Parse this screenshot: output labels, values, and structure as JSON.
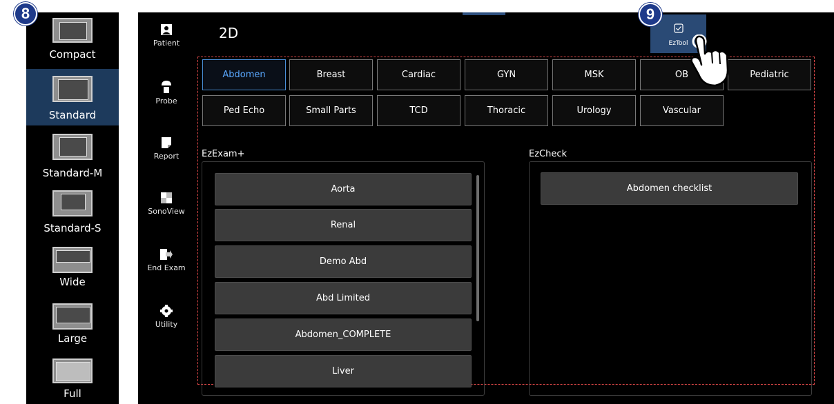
{
  "markers": {
    "left_panel": "8",
    "eztool": "9"
  },
  "layouts": [
    {
      "label": "Compact",
      "selected": false
    },
    {
      "label": "Standard",
      "selected": true
    },
    {
      "label": "Standard-M",
      "selected": false
    },
    {
      "label": "Standard-S",
      "selected": false
    },
    {
      "label": "Wide",
      "selected": false
    },
    {
      "label": "Large",
      "selected": false
    },
    {
      "label": "Full",
      "selected": false
    }
  ],
  "nav": [
    {
      "label": "Patient",
      "icon": "patient-icon"
    },
    {
      "label": "Probe",
      "icon": "probe-icon"
    },
    {
      "label": "Report",
      "icon": "report-icon"
    },
    {
      "label": "SonoView",
      "icon": "sonoview-icon"
    },
    {
      "label": "End Exam",
      "icon": "end-exam-icon"
    },
    {
      "label": "Utility",
      "icon": "utility-icon"
    }
  ],
  "screen_title": "2D",
  "eztool": {
    "label": "EzTool",
    "icon": "checkbox-icon"
  },
  "tabs_row1": [
    "Abdomen",
    "Breast",
    "Cardiac",
    "GYN",
    "MSK",
    "OB",
    "Pediatric"
  ],
  "tabs_row2": [
    "Ped Echo",
    "Small Parts",
    "TCD",
    "Thoracic",
    "Urology",
    "Vascular"
  ],
  "selected_tab": "Abdomen",
  "ezexam": {
    "title": "EzExam+",
    "items": [
      "Aorta",
      "Renal",
      "Demo Abd",
      "Abd Limited",
      "Abdomen_COMPLETE",
      "Liver"
    ]
  },
  "ezcheck": {
    "title": "EzCheck",
    "items": [
      "Abdomen checklist"
    ]
  },
  "colors": {
    "accent": "#2a4a75",
    "selected_tab_border": "#4a8fd8",
    "badge": "#1e3a8a",
    "highlight_frame": "#e04848"
  }
}
